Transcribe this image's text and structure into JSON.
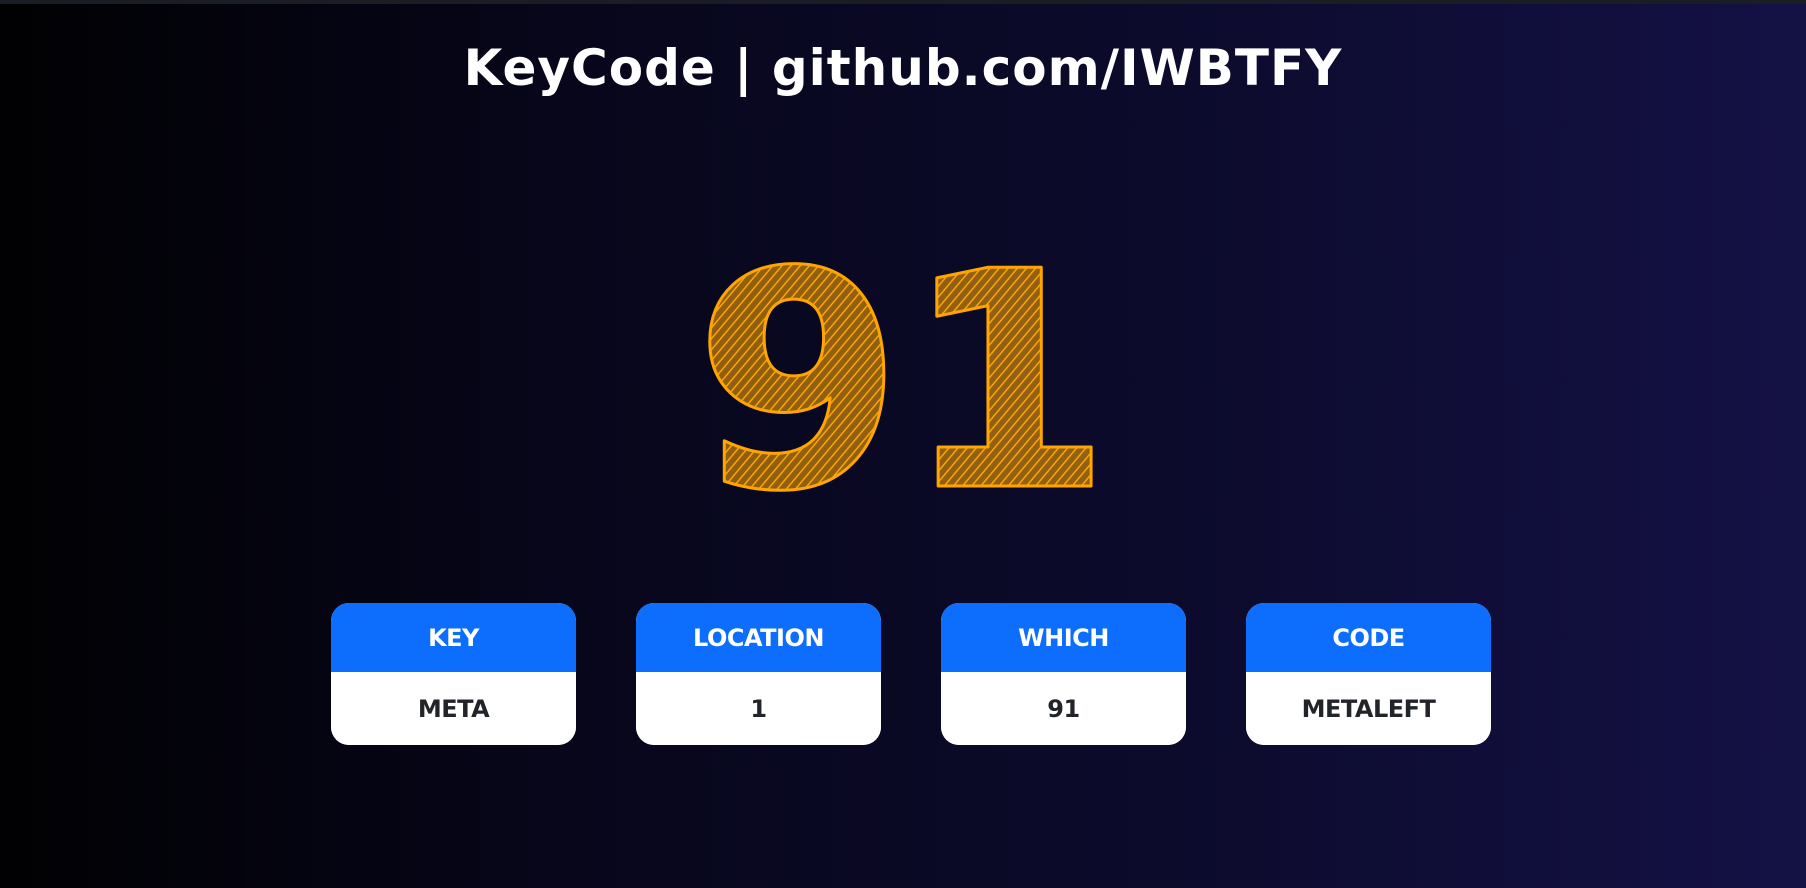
{
  "header": {
    "title": "KeyCode | github.com/IWBTFY"
  },
  "key_display": {
    "value": "91",
    "color": "#ffa500"
  },
  "cards": [
    {
      "label": "KEY",
      "value": "META"
    },
    {
      "label": "LOCATION",
      "value": "1"
    },
    {
      "label": "WHICH",
      "value": "91"
    },
    {
      "label": "CODE",
      "value": "METALEFT"
    }
  ],
  "colors": {
    "card_header": "#0d6efd",
    "card_body": "#ffffff",
    "card_text": "#212529",
    "title_text": "#ffffff"
  }
}
